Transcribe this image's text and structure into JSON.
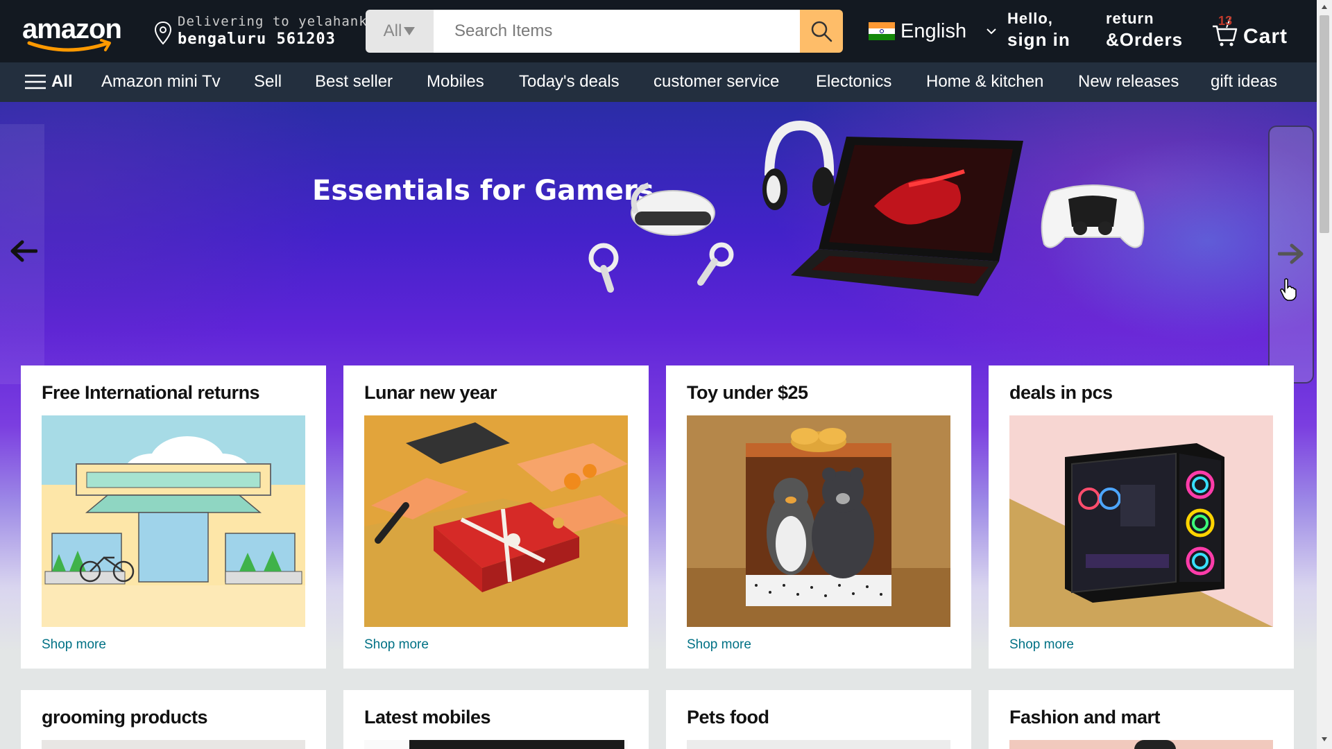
{
  "header": {
    "logo_text": "amazon",
    "deliver_line1": "Delivering to  yelahanka",
    "deliver_line2": "bengaluru 561203",
    "search_category": "All",
    "search_placeholder": "Search Items",
    "language": "English",
    "hello_line1": "Hello,",
    "hello_line2": "sign in",
    "returns_line1": "return",
    "returns_line2": "&Orders",
    "cart_count": "13",
    "cart_label": "Cart"
  },
  "subnav": {
    "items": [
      "All",
      "Amazon mini Tv",
      "Sell",
      "Best seller",
      "Mobiles",
      "Today's deals",
      "customer service",
      "Electonics",
      "Home & kitchen",
      "New releases",
      "gift ideas"
    ]
  },
  "hero": {
    "title": "Essentials for Gamers"
  },
  "cards": [
    {
      "title": "Free International returns",
      "link": "Shop more",
      "image": "storefront-illustration"
    },
    {
      "title": "Lunar new year",
      "link": "Shop more",
      "image": "gift-boxes-and-iron"
    },
    {
      "title": "Toy under $25",
      "link": "Shop more",
      "image": "plush-toys-in-box"
    },
    {
      "title": "deals in pcs",
      "link": "Shop more",
      "image": "gaming-pc-case"
    },
    {
      "title": "grooming products",
      "link": "",
      "image": "grooming"
    },
    {
      "title": "Latest mobiles",
      "link": "",
      "image": "mobiles"
    },
    {
      "title": "Pets food",
      "link": "",
      "image": "pets-food"
    },
    {
      "title": "Fashion and mart",
      "link": "",
      "image": "fashion"
    }
  ],
  "colors": {
    "nav_bg": "#131921",
    "subnav_bg": "#232f3e",
    "search_button": "#febd69",
    "link": "#007185",
    "brand_orange": "#ff9900"
  }
}
